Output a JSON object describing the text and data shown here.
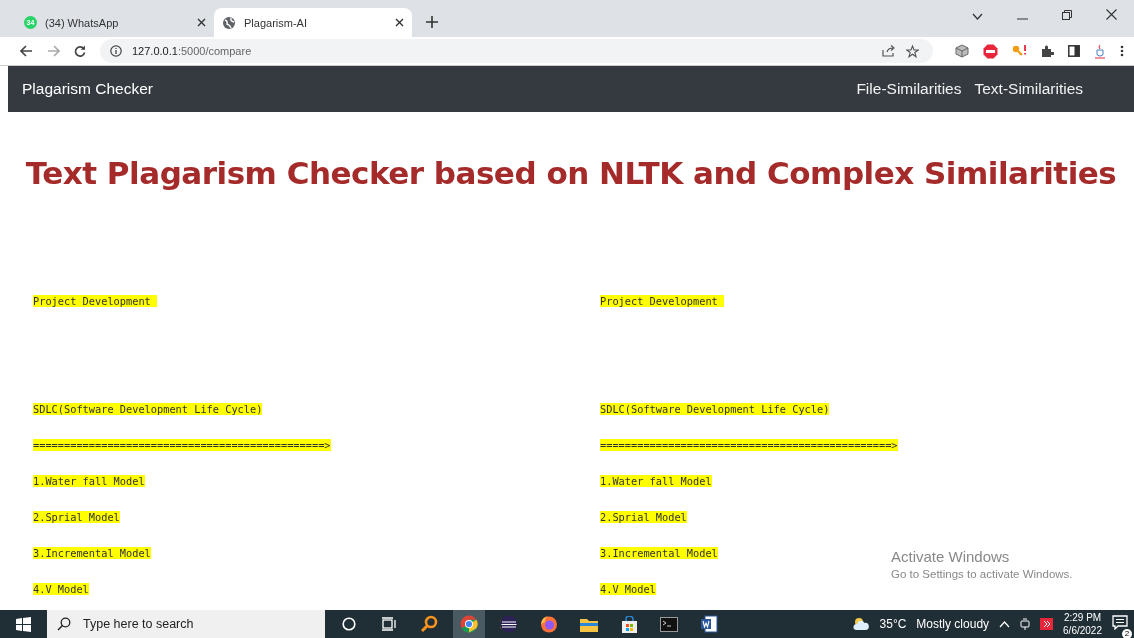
{
  "browser": {
    "tabs": [
      {
        "title": "(34) WhatsApp",
        "badge": "34",
        "kind": "whatsapp",
        "selected": false
      },
      {
        "title": "Plagarism-AI",
        "kind": "globe",
        "selected": true
      }
    ],
    "address_host": "127.0.0.1",
    "address_path": ":5000/compare"
  },
  "navbar": {
    "brand": "Plagarism Checker",
    "links": [
      "File-Similarities",
      "Text-Similarities"
    ]
  },
  "heading": "Text Plagarism Checker based on NLTK and Complex Similarities",
  "columns": [
    {
      "lines": [
        "Project Development ",
        "SDLC(Software Development Life Cycle)",
        "===============================================>",
        "1.Water fall Model",
        "2.Sprial Model",
        "3.Incremental Model",
        "4.V Model"
      ]
    },
    {
      "lines": [
        "Project Development ",
        "SDLC(Software Development Life Cycle)",
        "===============================================>",
        "1.Water fall Model",
        "2.Sprial Model",
        "3.Incremental Model",
        "4.V Model"
      ]
    }
  ],
  "activation_notice": {
    "title": "Activate Windows",
    "subtitle": "Go to Settings to activate Windows."
  },
  "taskbar": {
    "search_placeholder": "Type here to search",
    "apps": [
      {
        "kind": "cortana",
        "selected": false
      },
      {
        "kind": "taskview",
        "selected": false
      },
      {
        "kind": "magnifier",
        "selected": false
      },
      {
        "kind": "chrome",
        "selected": true
      },
      {
        "kind": "eclipse",
        "selected": false
      },
      {
        "kind": "firefox",
        "selected": false
      },
      {
        "kind": "folder",
        "selected": false
      },
      {
        "kind": "store",
        "selected": false
      },
      {
        "kind": "terminal",
        "selected": false
      },
      {
        "kind": "word",
        "selected": false
      }
    ],
    "weather_temp": "35°C",
    "weather_text": "Mostly cloudy",
    "time": "2:29 PM",
    "date": "6/6/2022",
    "notification_count": "2"
  }
}
